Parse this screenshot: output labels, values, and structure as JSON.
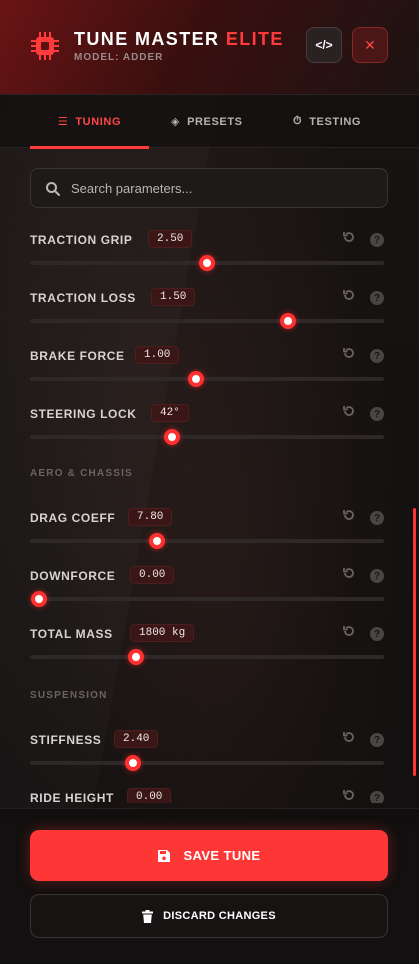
{
  "header": {
    "title_main": "TUNE MASTER",
    "title_accent": "ELITE",
    "subtitle": "MODEL: ADDER",
    "code_label": "</>",
    "close_label": "✕"
  },
  "tabs": [
    {
      "label": "TUNING",
      "icon": "sliders-icon",
      "active": true
    },
    {
      "label": "PRESETS",
      "icon": "layers-icon",
      "active": false
    },
    {
      "label": "TESTING",
      "icon": "stopwatch-icon",
      "active": false
    }
  ],
  "search": {
    "placeholder": "Search parameters..."
  },
  "params": [
    {
      "label": "TRACTION GRIP",
      "value": "2.50",
      "level": 0.5
    },
    {
      "label": "TRACTION LOSS",
      "value": "1.50",
      "level": 0.73
    },
    {
      "label": "BRAKE FORCE",
      "value": "1.00",
      "level": 0.47
    },
    {
      "label": "STEERING LOCK",
      "value": "42°",
      "level": 0.4
    },
    {
      "label": "DRAG COEFF",
      "value": "7.80",
      "level": 0.36
    },
    {
      "label": "DOWNFORCE",
      "value": "0.00",
      "level": 0.0
    },
    {
      "label": "TOTAL MASS",
      "value": "1800 kg",
      "level": 0.3
    },
    {
      "label": "STIFFNESS",
      "value": "2.40",
      "level": 0.29
    },
    {
      "label": "RIDE HEIGHT",
      "value": "0.00",
      "level": 0.0
    }
  ],
  "sections": {
    "aero": "AERO & CHASSIS",
    "suspension": "SUSPENSION"
  },
  "footer": {
    "save_label": "SAVE TUNE",
    "discard_label": "DISCARD CHANGES"
  },
  "colors": {
    "accent": "#ff3b3b",
    "header_bg": "#6a1414",
    "panel_bg": "#141111"
  }
}
